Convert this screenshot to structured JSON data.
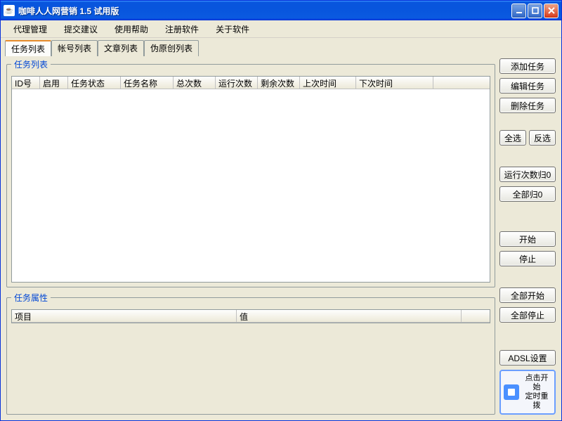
{
  "window": {
    "title": "咖啡人人网营销 1.5 试用版"
  },
  "menu": [
    "代理管理",
    "提交建议",
    "使用帮助",
    "注册软件",
    "关于软件"
  ],
  "tabs": [
    {
      "label": "任务列表",
      "active": true
    },
    {
      "label": "帐号列表",
      "active": false
    },
    {
      "label": "文章列表",
      "active": false
    },
    {
      "label": "伪原创列表",
      "active": false
    }
  ],
  "task_group_legend": "任务列表",
  "task_columns": [
    "ID号",
    "启用",
    "任务状态",
    "任务名称",
    "总次数",
    "运行次数",
    "剩余次数",
    "上次时间",
    "下次时间"
  ],
  "task_col_widths": [
    40,
    40,
    75,
    75,
    60,
    60,
    60,
    80,
    110
  ],
  "prop_group_legend": "任务属性",
  "prop_columns": [
    "项目",
    "值"
  ],
  "prop_col_widths": [
    320,
    320
  ],
  "buttons": {
    "add": "添加任务",
    "edit": "编辑任务",
    "del": "删除任务",
    "sel_all": "全选",
    "sel_inv": "反选",
    "reset_run": "运行次数归0",
    "reset_all": "全部归0",
    "start": "开始",
    "stop": "停止",
    "start_all": "全部开始",
    "stop_all": "全部停止",
    "adsl": "ADSL设置",
    "adsl_label": "点击开始\n定时重拨"
  }
}
